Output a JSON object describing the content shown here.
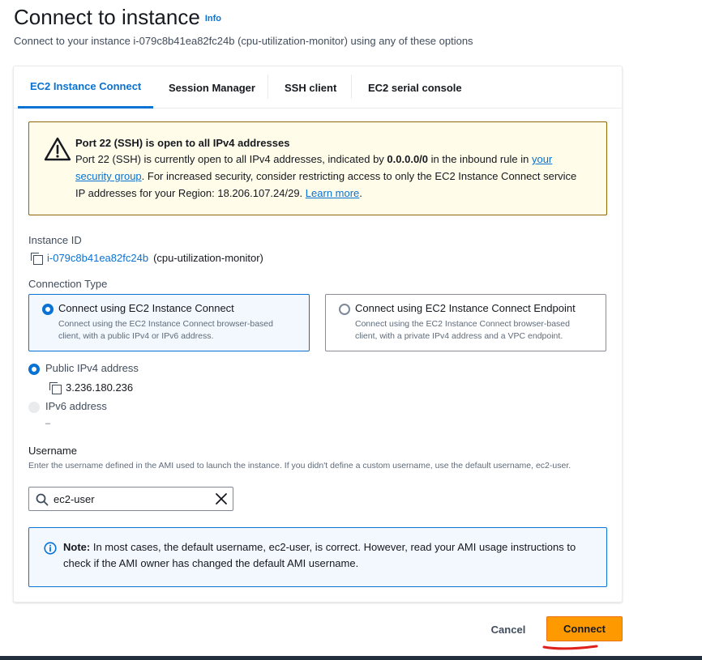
{
  "header": {
    "title": "Connect to instance",
    "info_label": "Info",
    "subtitle": "Connect to your instance i-079c8b41ea82fc24b (cpu-utilization-monitor) using any of these options"
  },
  "tabs": [
    {
      "label": "EC2 Instance Connect",
      "active": true
    },
    {
      "label": "Session Manager",
      "active": false
    },
    {
      "label": "SSH client",
      "active": false
    },
    {
      "label": "EC2 serial console",
      "active": false
    }
  ],
  "warning": {
    "title": "Port 22 (SSH) is open to all IPv4 addresses",
    "text_1": "Port 22 (SSH) is currently open to all IPv4 addresses, indicated by ",
    "bold_cidr": "0.0.0.0/0",
    "text_2": " in the inbound rule in ",
    "link_security_group": "your security group",
    "text_3": ". For increased security, consider restricting access to only the EC2 Instance Connect service IP addresses for your Region: 18.206.107.24/29. ",
    "link_learn_more": "Learn more",
    "text_4": "."
  },
  "instance": {
    "label": "Instance ID",
    "id": "i-079c8b41ea82fc24b",
    "name": "(cpu-utilization-monitor)"
  },
  "connection_type": {
    "label": "Connection Type",
    "options": [
      {
        "title": "Connect using EC2 Instance Connect",
        "description": "Connect using the EC2 Instance Connect browser-based client, with a public IPv4 or IPv6 address.",
        "selected": true
      },
      {
        "title": "Connect using EC2 Instance Connect Endpoint",
        "description": "Connect using the EC2 Instance Connect browser-based client, with a private IPv4 address and a VPC endpoint.",
        "selected": false
      }
    ]
  },
  "address": {
    "public_ipv4_label": "Public IPv4 address",
    "public_ipv4_value": "3.236.180.236",
    "ipv6_label": "IPv6 address",
    "ipv6_value": "–"
  },
  "username": {
    "label": "Username",
    "description": "Enter the username defined in the AMI used to launch the instance. If you didn't define a custom username, use the default username, ec2-user.",
    "value": "ec2-user"
  },
  "note": {
    "bold": "Note:",
    "text": " In most cases, the default username, ec2-user, is correct. However, read your AMI usage instructions to check if the AMI owner has changed the default AMI username."
  },
  "footer": {
    "cancel_label": "Cancel",
    "connect_label": "Connect"
  },
  "colors": {
    "accent": "#0972d3",
    "primary_button": "#ff9900",
    "warning_bg": "#fffce9",
    "info_bg": "#f2f8fd",
    "annotation_red": "#e0201b"
  }
}
